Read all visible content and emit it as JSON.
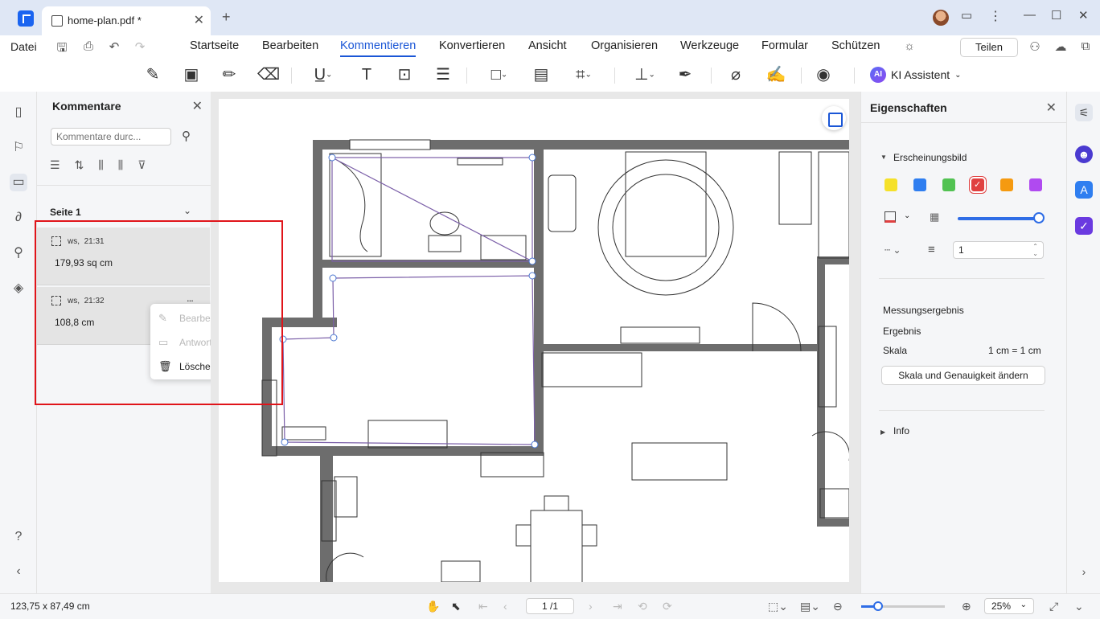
{
  "titlebar": {
    "tab_name": "home-plan.pdf *"
  },
  "menubar": {
    "file": "Datei",
    "tabs": [
      "Startseite",
      "Bearbeiten",
      "Kommentieren",
      "Konvertieren",
      "Ansicht",
      "Organisieren",
      "Werkzeuge",
      "Formular",
      "Schützen"
    ],
    "active_tab": "Kommentieren",
    "share": "Teilen"
  },
  "toolbar": {
    "ai_badge": "AI",
    "ai_label": "KI Assistent"
  },
  "comments_panel": {
    "title": "Kommentare",
    "search_placeholder": "Kommentare durc...",
    "page_label": "Seite 1",
    "items": [
      {
        "author": "ws,",
        "time": "21:31",
        "value": "179,93 sq cm"
      },
      {
        "author": "ws,",
        "time": "21:32",
        "value": "108,8 cm",
        "more": "..."
      }
    ]
  },
  "context_menu": {
    "items": [
      {
        "label": "Bearbeiten",
        "enabled": false
      },
      {
        "label": "Antworten",
        "enabled": false
      },
      {
        "label": "Löschen",
        "enabled": true
      }
    ]
  },
  "properties": {
    "title": "Eigenschaften",
    "appearance": "Erscheinungsbild",
    "colors": [
      "#f5e12a",
      "#2f7ef0",
      "#52c252",
      "#e04040",
      "#f59a10",
      "#b04af0"
    ],
    "selected_color": "#e04040",
    "line_width": "1",
    "measure_title": "Messungsergebnis",
    "result_label": "Ergebnis",
    "scale_label": "Skala",
    "scale_value": "1 cm = 1 cm",
    "scale_button": "Skala und Genauigkeit ändern",
    "info": "Info"
  },
  "statusbar": {
    "dimensions": "123,75 x 87,49 cm",
    "page": "1 /1",
    "zoom": "25%"
  }
}
